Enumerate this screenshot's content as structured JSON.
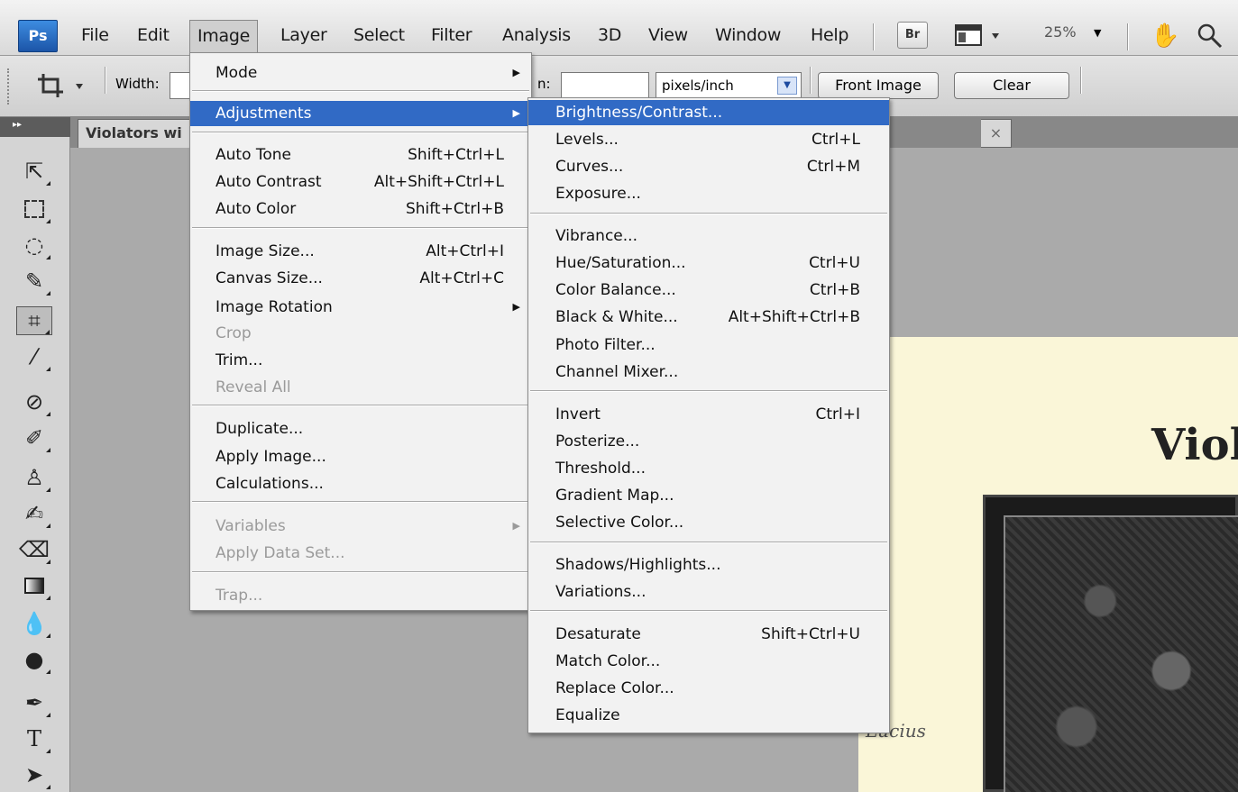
{
  "app": {
    "logo": "Ps"
  },
  "menubar": {
    "items": [
      "File",
      "Edit",
      "Image",
      "Layer",
      "Select",
      "Filter",
      "Analysis",
      "3D",
      "View",
      "Window",
      "Help"
    ],
    "bridge_label": "Br",
    "zoom": "25%"
  },
  "options": {
    "width_label": "Width:",
    "res_label_partial": "n:",
    "units": "pixels/inch",
    "front_image": "Front Image",
    "clear": "Clear"
  },
  "document": {
    "tab_title": "Violators wi",
    "close_glyph": "×",
    "image_title": "Viol",
    "handwriting": "Lucius"
  },
  "image_menu": {
    "items": [
      {
        "label": "Mode",
        "submenu": true
      },
      {
        "label": "Adjustments",
        "submenu": true,
        "highlight": true
      },
      {
        "label": "Auto Tone",
        "shortcut": "Shift+Ctrl+L"
      },
      {
        "label": "Auto Contrast",
        "shortcut": "Alt+Shift+Ctrl+L"
      },
      {
        "label": "Auto Color",
        "shortcut": "Shift+Ctrl+B"
      },
      {
        "label": "Image Size...",
        "shortcut": "Alt+Ctrl+I"
      },
      {
        "label": "Canvas Size...",
        "shortcut": "Alt+Ctrl+C"
      },
      {
        "label": "Image Rotation",
        "submenu": true
      },
      {
        "label": "Crop",
        "disabled": true
      },
      {
        "label": "Trim..."
      },
      {
        "label": "Reveal All",
        "disabled": true
      },
      {
        "label": "Duplicate..."
      },
      {
        "label": "Apply Image..."
      },
      {
        "label": "Calculations..."
      },
      {
        "label": "Variables",
        "submenu": true,
        "disabled": true
      },
      {
        "label": "Apply Data Set...",
        "disabled": true
      },
      {
        "label": "Trap...",
        "disabled": true
      }
    ]
  },
  "adjustments_menu": {
    "items": [
      {
        "label": "Brightness/Contrast...",
        "highlight": true
      },
      {
        "label": "Levels...",
        "shortcut": "Ctrl+L"
      },
      {
        "label": "Curves...",
        "shortcut": "Ctrl+M"
      },
      {
        "label": "Exposure..."
      },
      {
        "label": "Vibrance..."
      },
      {
        "label": "Hue/Saturation...",
        "shortcut": "Ctrl+U"
      },
      {
        "label": "Color Balance...",
        "shortcut": "Ctrl+B"
      },
      {
        "label": "Black & White...",
        "shortcut": "Alt+Shift+Ctrl+B"
      },
      {
        "label": "Photo Filter..."
      },
      {
        "label": "Channel Mixer..."
      },
      {
        "label": "Invert",
        "shortcut": "Ctrl+I"
      },
      {
        "label": "Posterize..."
      },
      {
        "label": "Threshold..."
      },
      {
        "label": "Gradient Map..."
      },
      {
        "label": "Selective Color..."
      },
      {
        "label": "Shadows/Highlights..."
      },
      {
        "label": "Variations..."
      },
      {
        "label": "Desaturate",
        "shortcut": "Shift+Ctrl+U"
      },
      {
        "label": "Match Color..."
      },
      {
        "label": "Replace Color..."
      },
      {
        "label": "Equalize"
      }
    ]
  },
  "colors": {
    "highlight": "#316ac5",
    "disabled_text": "#9a9a9a"
  }
}
